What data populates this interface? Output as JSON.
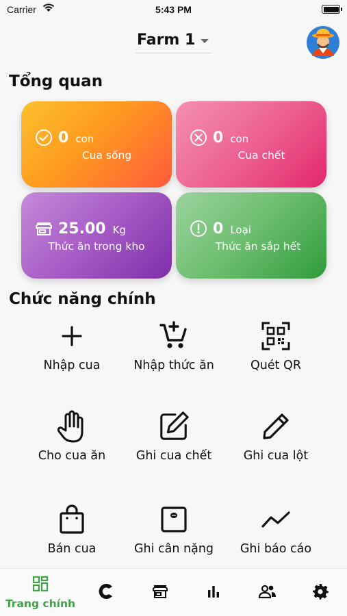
{
  "status_bar": {
    "carrier": "Carrier",
    "time": "5:43 PM"
  },
  "header": {
    "farm_name": "Farm 1"
  },
  "overview": {
    "title": "Tổng quan",
    "cards": {
      "alive": {
        "value": "0",
        "unit": "con",
        "label": "Cua sống",
        "icon": "check-circle-icon"
      },
      "dead": {
        "value": "0",
        "unit": "con",
        "label": "Cua chết",
        "icon": "x-circle-icon"
      },
      "food": {
        "value": "25.00",
        "unit": "Kg",
        "label": "Thức ăn trong kho",
        "icon": "store-icon"
      },
      "low": {
        "value": "0",
        "unit": "Loại",
        "label": "Thức ăn sắp hết",
        "icon": "alert-circle-icon"
      }
    }
  },
  "functions": {
    "title": "Chức năng chính",
    "items": [
      {
        "label": "Nhập cua",
        "icon": "plus-icon"
      },
      {
        "label": "Nhập thức ăn",
        "icon": "cart-plus-icon"
      },
      {
        "label": "Quét QR",
        "icon": "qr-scan-icon"
      },
      {
        "label": "Cho cua ăn",
        "icon": "hand-icon"
      },
      {
        "label": "Ghi cua chết",
        "icon": "edit-box-icon"
      },
      {
        "label": "Ghi cua lột",
        "icon": "pencil-icon"
      },
      {
        "label": "Bán cua",
        "icon": "shopping-bag-icon"
      },
      {
        "label": "Ghi cân nặng",
        "icon": "scale-icon"
      },
      {
        "label": "Ghi báo cáo",
        "icon": "trend-line-icon"
      }
    ]
  },
  "tabbar": {
    "active_label": "Trang chính",
    "active_color": "#43a047",
    "tabs": [
      "dashboard-icon",
      "crab-logo-icon",
      "store-icon",
      "bar-chart-icon",
      "people-icon",
      "gear-icon"
    ]
  }
}
